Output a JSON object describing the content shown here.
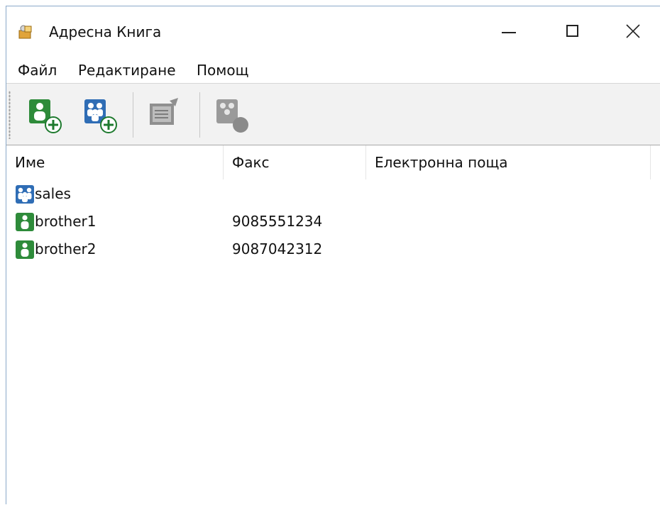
{
  "window": {
    "title": "Адресна Книга"
  },
  "menu": {
    "items": [
      "Файл",
      "Редактиране",
      "Помощ"
    ]
  },
  "toolbar": {
    "buttons": [
      {
        "icon": "add-contact-icon",
        "enabled": true
      },
      {
        "icon": "add-group-icon",
        "enabled": true
      },
      {
        "icon": "edit-icon",
        "enabled": false
      },
      {
        "icon": "delete-icon",
        "enabled": false
      }
    ]
  },
  "columns": [
    "Име",
    "Факс",
    "Електронна поща"
  ],
  "rows": [
    {
      "type": "group",
      "icon": "group-icon",
      "name": "sales",
      "fax": "",
      "email": ""
    },
    {
      "type": "contact",
      "icon": "contact-icon",
      "name": "brother1",
      "fax": "9085551234",
      "email": ""
    },
    {
      "type": "contact",
      "icon": "contact-icon",
      "name": "brother2",
      "fax": "9087042312",
      "email": ""
    }
  ],
  "colors": {
    "contact": "#2e8b3a",
    "group": "#2f6db5",
    "disabled": "#8a8a8a"
  }
}
